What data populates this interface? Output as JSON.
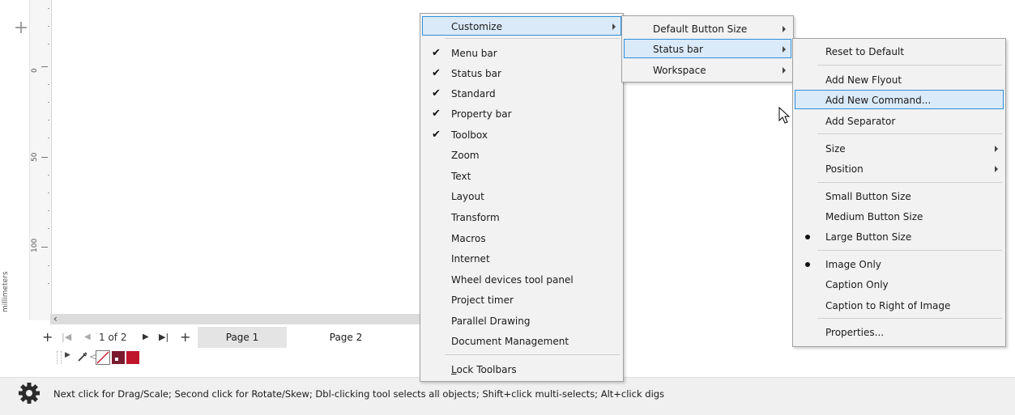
{
  "ruler": {
    "labels": [
      "0",
      "50",
      "100"
    ],
    "unit": "millimeters"
  },
  "page_nav": {
    "page_indicator": "1 of 2",
    "tabs": [
      "Page 1",
      "Page 2"
    ]
  },
  "main_menu": {
    "customize": "Customize",
    "items": [
      {
        "label": "Menu bar",
        "checked": true
      },
      {
        "label": "Status bar",
        "checked": true
      },
      {
        "label": "Standard",
        "checked": true
      },
      {
        "label": "Property bar",
        "checked": true
      },
      {
        "label": "Toolbox",
        "checked": true
      },
      {
        "label": "Zoom",
        "checked": false
      },
      {
        "label": "Text",
        "checked": false
      },
      {
        "label": "Layout",
        "checked": false
      },
      {
        "label": "Transform",
        "checked": false
      },
      {
        "label": "Macros",
        "checked": false
      },
      {
        "label": "Internet",
        "checked": false
      },
      {
        "label": "Wheel devices tool panel",
        "checked": false
      },
      {
        "label": "Project timer",
        "checked": false
      },
      {
        "label": "Parallel Drawing",
        "checked": false
      },
      {
        "label": "Document Management",
        "checked": false
      }
    ],
    "lock_toolbars": "Lock Toolbars"
  },
  "customize_menu": {
    "items": [
      "Default Button Size",
      "Status bar",
      "Workspace"
    ]
  },
  "statusbar_menu": {
    "reset": "Reset to Default",
    "add_flyout": "Add New Flyout",
    "add_command": "Add New Command...",
    "add_separator": "Add Separator",
    "size": "Size",
    "position": "Position",
    "small": "Small Button Size",
    "medium": "Medium Button Size",
    "large": "Large Button Size",
    "image_only": "Image Only",
    "caption_only": "Caption Only",
    "caption_right": "Caption to Right of Image",
    "properties": "Properties..."
  },
  "status_bar": {
    "hint": "Next click for Drag/Scale; Second click for Rotate/Skew; Dbl-clicking tool selects all objects; Shift+click multi-selects; Alt+click digs"
  },
  "colors": {
    "highlight_bg": "#dbeaf9",
    "highlight_border": "#2f8fd8",
    "swatch_dark_red": "#7a1a2e",
    "swatch_red": "#c0162c"
  }
}
